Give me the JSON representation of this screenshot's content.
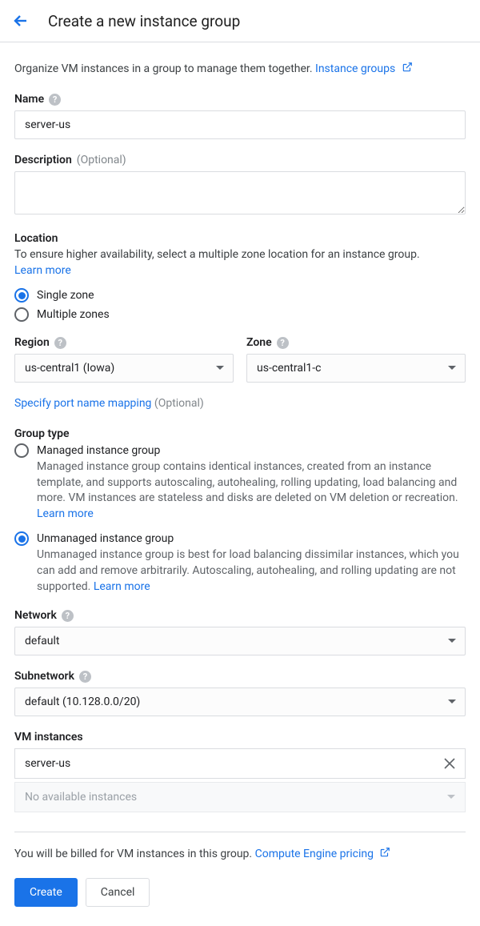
{
  "header": {
    "title": "Create a new instance group"
  },
  "intro": {
    "text": "Organize VM instances in a group to manage them together.",
    "link": "Instance groups"
  },
  "name": {
    "label": "Name",
    "value": "server-us"
  },
  "description": {
    "label": "Description",
    "optional": "(Optional)",
    "value": ""
  },
  "location": {
    "title": "Location",
    "desc": "To ensure higher availability, select a multiple zone location for an instance group.",
    "learn": "Learn more",
    "options": {
      "single": "Single zone",
      "multiple": "Multiple zones"
    }
  },
  "region": {
    "label": "Region",
    "value": "us-central1 (Iowa)"
  },
  "zone": {
    "label": "Zone",
    "value": "us-central1-c"
  },
  "portMapping": {
    "link": "Specify port name mapping",
    "optional": "(Optional)"
  },
  "groupType": {
    "title": "Group type",
    "managed": {
      "label": "Managed instance group",
      "desc": "Managed instance group contains identical instances, created from an instance template, and supports autoscaling, autohealing, rolling updating, load balancing and more. VM instances are stateless and disks are deleted on VM deletion or recreation.",
      "learn": "Learn more"
    },
    "unmanaged": {
      "label": "Unmanaged instance group",
      "desc": "Unmanaged instance group is best for load balancing dissimilar instances, which you can add and remove arbitrarily. Autoscaling, autohealing, and rolling updating are not supported.",
      "learn": "Learn more"
    }
  },
  "network": {
    "label": "Network",
    "value": "default"
  },
  "subnetwork": {
    "label": "Subnetwork",
    "value": "default (10.128.0.0/20)"
  },
  "vmInstances": {
    "label": "VM instances",
    "item": "server-us",
    "empty": "No available instances"
  },
  "billing": {
    "text": "You will be billed for VM instances in this group.",
    "link": "Compute Engine pricing"
  },
  "buttons": {
    "create": "Create",
    "cancel": "Cancel"
  }
}
